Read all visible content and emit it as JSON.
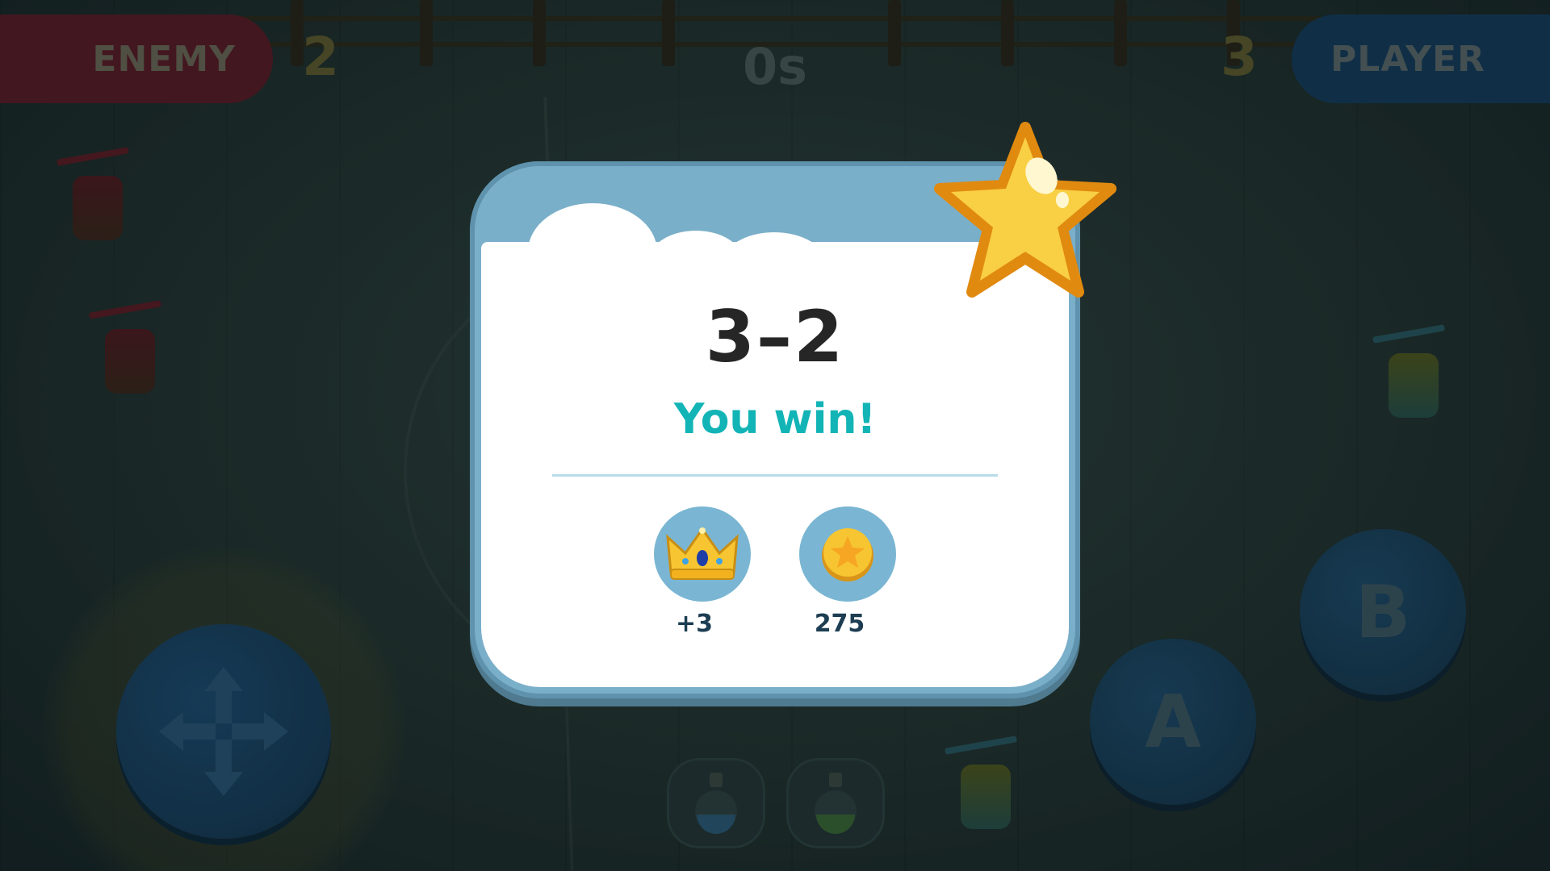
{
  "hud": {
    "enemy_label": "ENEMY",
    "enemy_score": "2",
    "timer": "0s",
    "player_score": "3",
    "player_label": "PLAYER"
  },
  "result_dialog": {
    "score": "3–2",
    "message": "You win!",
    "rewards": [
      {
        "icon": "crown-icon",
        "value": "+3"
      },
      {
        "icon": "coin-icon",
        "value": "275"
      }
    ]
  },
  "controls": {
    "button_a": "A",
    "button_b": "B",
    "potions": [
      {
        "icon": "blue-potion-icon"
      },
      {
        "icon": "green-potion-icon"
      }
    ]
  },
  "colors": {
    "enemy": "#5a1f2b",
    "player": "#163f5f",
    "win_text": "#12b4b6",
    "dialog_frame": "#7aafc9",
    "star": "#f7c531"
  }
}
